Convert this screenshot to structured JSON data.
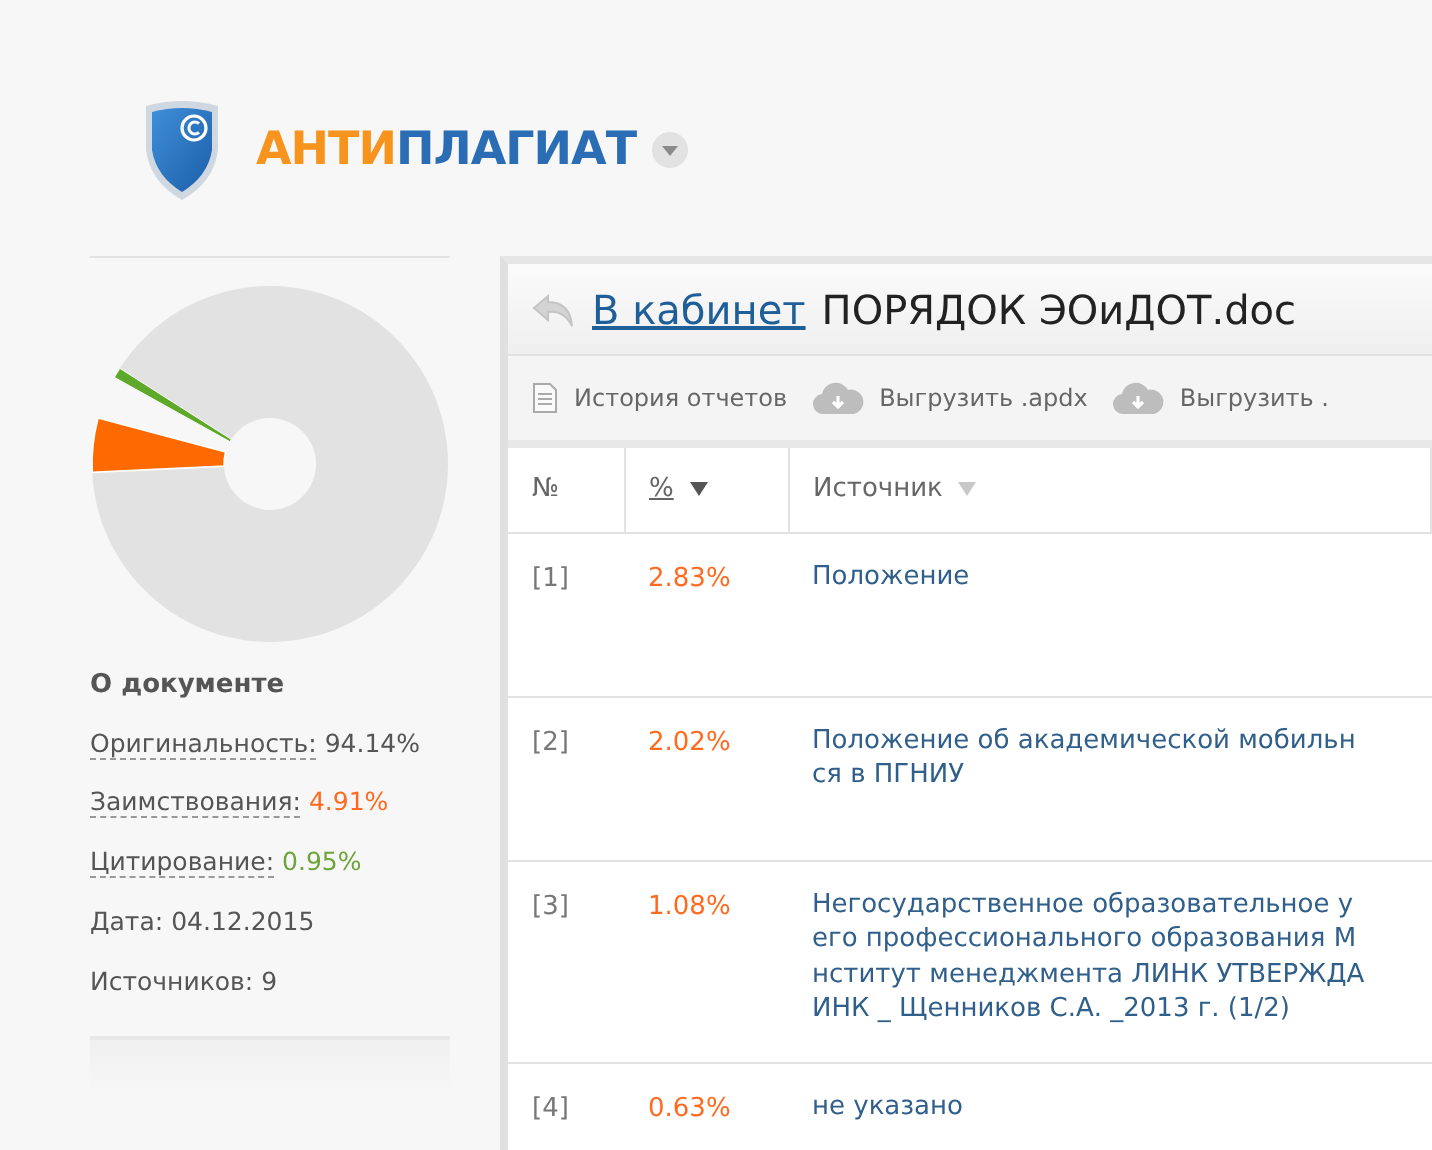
{
  "logo": {
    "part_1": "АНТИ",
    "part_2": "ПЛАГИАТ"
  },
  "about": {
    "title": "О документе",
    "items": [
      {
        "kind": "term",
        "label": "Оригинальность:",
        "value": "94.14%",
        "color": "#555555"
      },
      {
        "kind": "term",
        "label": "Заимствования:",
        "value": "4.91%",
        "color": "#ff6a1f"
      },
      {
        "kind": "term",
        "label": "Цитирование:",
        "value": "0.95%",
        "color": "#6ea43a"
      },
      {
        "kind": "plain",
        "label": "Дата:",
        "value": "04.12.2015",
        "color": "#555555"
      },
      {
        "kind": "plain",
        "label": "Источников:",
        "value": "9",
        "color": "#555555"
      }
    ]
  },
  "report": {
    "back_link": "В кабинет",
    "title": "ПОРЯДОК ЭОиДОТ.doc",
    "toolbar": [
      {
        "kind": "document",
        "label": "История отчетов"
      },
      {
        "kind": "download",
        "label": "Выгрузить .apdx"
      },
      {
        "kind": "download",
        "label": "Выгрузить ."
      }
    ],
    "columns": [
      {
        "kind": "plain",
        "label": "№",
        "sorted": false
      },
      {
        "kind": "sortable",
        "label": "%",
        "sorted": true
      },
      {
        "kind": "sortable",
        "label": "Источник",
        "sorted": false
      }
    ],
    "rows": [
      {
        "number": "[1]",
        "percent": "2.83%",
        "source": "Положение"
      },
      {
        "number": "[2]",
        "percent": "2.02%",
        "source": "Положение об академической мобильн\nся в ПГНИУ"
      },
      {
        "number": "[3]",
        "percent": "1.08%",
        "source": "Негосударственное образовательное у\nего профессионального образования М\nнститут менеджмента ЛИНК УТВЕРЖДА\nИНК _ Щенников С.А. _2013 г. (1/2)"
      },
      {
        "number": "[4]",
        "percent": "0.63%",
        "source": "не указано"
      }
    ]
  }
}
